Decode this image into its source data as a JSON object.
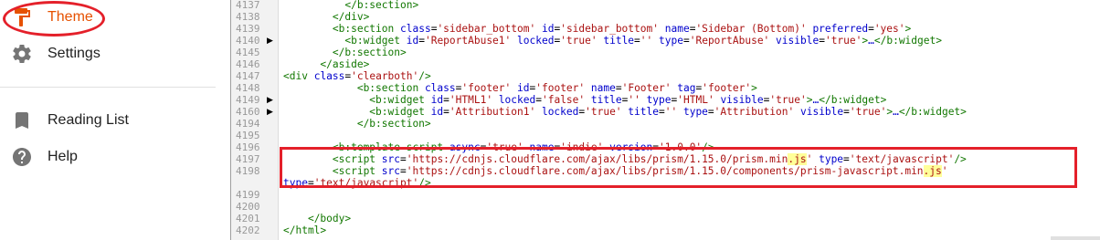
{
  "sidebar": {
    "items": [
      {
        "label": "Theme",
        "icon": "paint-roller-icon",
        "active": true
      },
      {
        "label": "Settings",
        "icon": "gear-icon"
      },
      {
        "label": "Reading List",
        "icon": "bookmark-icon"
      },
      {
        "label": "Help",
        "icon": "help-circle-icon"
      }
    ],
    "accent_color": "#e65100"
  },
  "editor": {
    "line_numbers": [
      "4137",
      "4138",
      "4139",
      "4140",
      "4145",
      "4146",
      "4147",
      "4148",
      "4149",
      "4160",
      "4194",
      "4195",
      "4196",
      "4197",
      "4198",
      "",
      "4199",
      "4200",
      "4201",
      "4202"
    ],
    "folded_lines": [
      "4140",
      "4149",
      "4160"
    ],
    "code_lines": [
      "          </b:section>",
      "        </div>",
      "        <b:section class='sidebar_bottom' id='sidebar_bottom' name='Sidebar (Bottom)' preferred='yes'>",
      "          <b:widget id='ReportAbuse1' locked='true' title='' type='ReportAbuse' visible='true'>…</b:widget>",
      "        </b:section>",
      "      </aside>",
      "<div class='clearboth'/>",
      "            <b:section class='footer' id='footer' name='Footer' tag='footer'>",
      "              <b:widget id='HTML1' locked='false' title='' type='HTML' visible='true'>…</b:widget>",
      "              <b:widget id='Attribution1' locked='true' title='' type='Attribution' visible='true'>…</b:widget>",
      "            </b:section>",
      "",
      "        <b:template-script async='true' name='indie' version='1.0.0'/>",
      "        <script src='https://cdnjs.cloudflare.com/ajax/libs/prism/1.15.0/prism.min.js' type='text/javascript'/>",
      "        <script src='https://cdnjs.cloudflare.com/ajax/libs/prism/1.15.0/components/prism-javascript.min.js'",
      "type='text/javascript'/>",
      "",
      "",
      "    </body>",
      "</html>"
    ],
    "highlight_term": ".js",
    "annotation_color": "#e4202a"
  }
}
